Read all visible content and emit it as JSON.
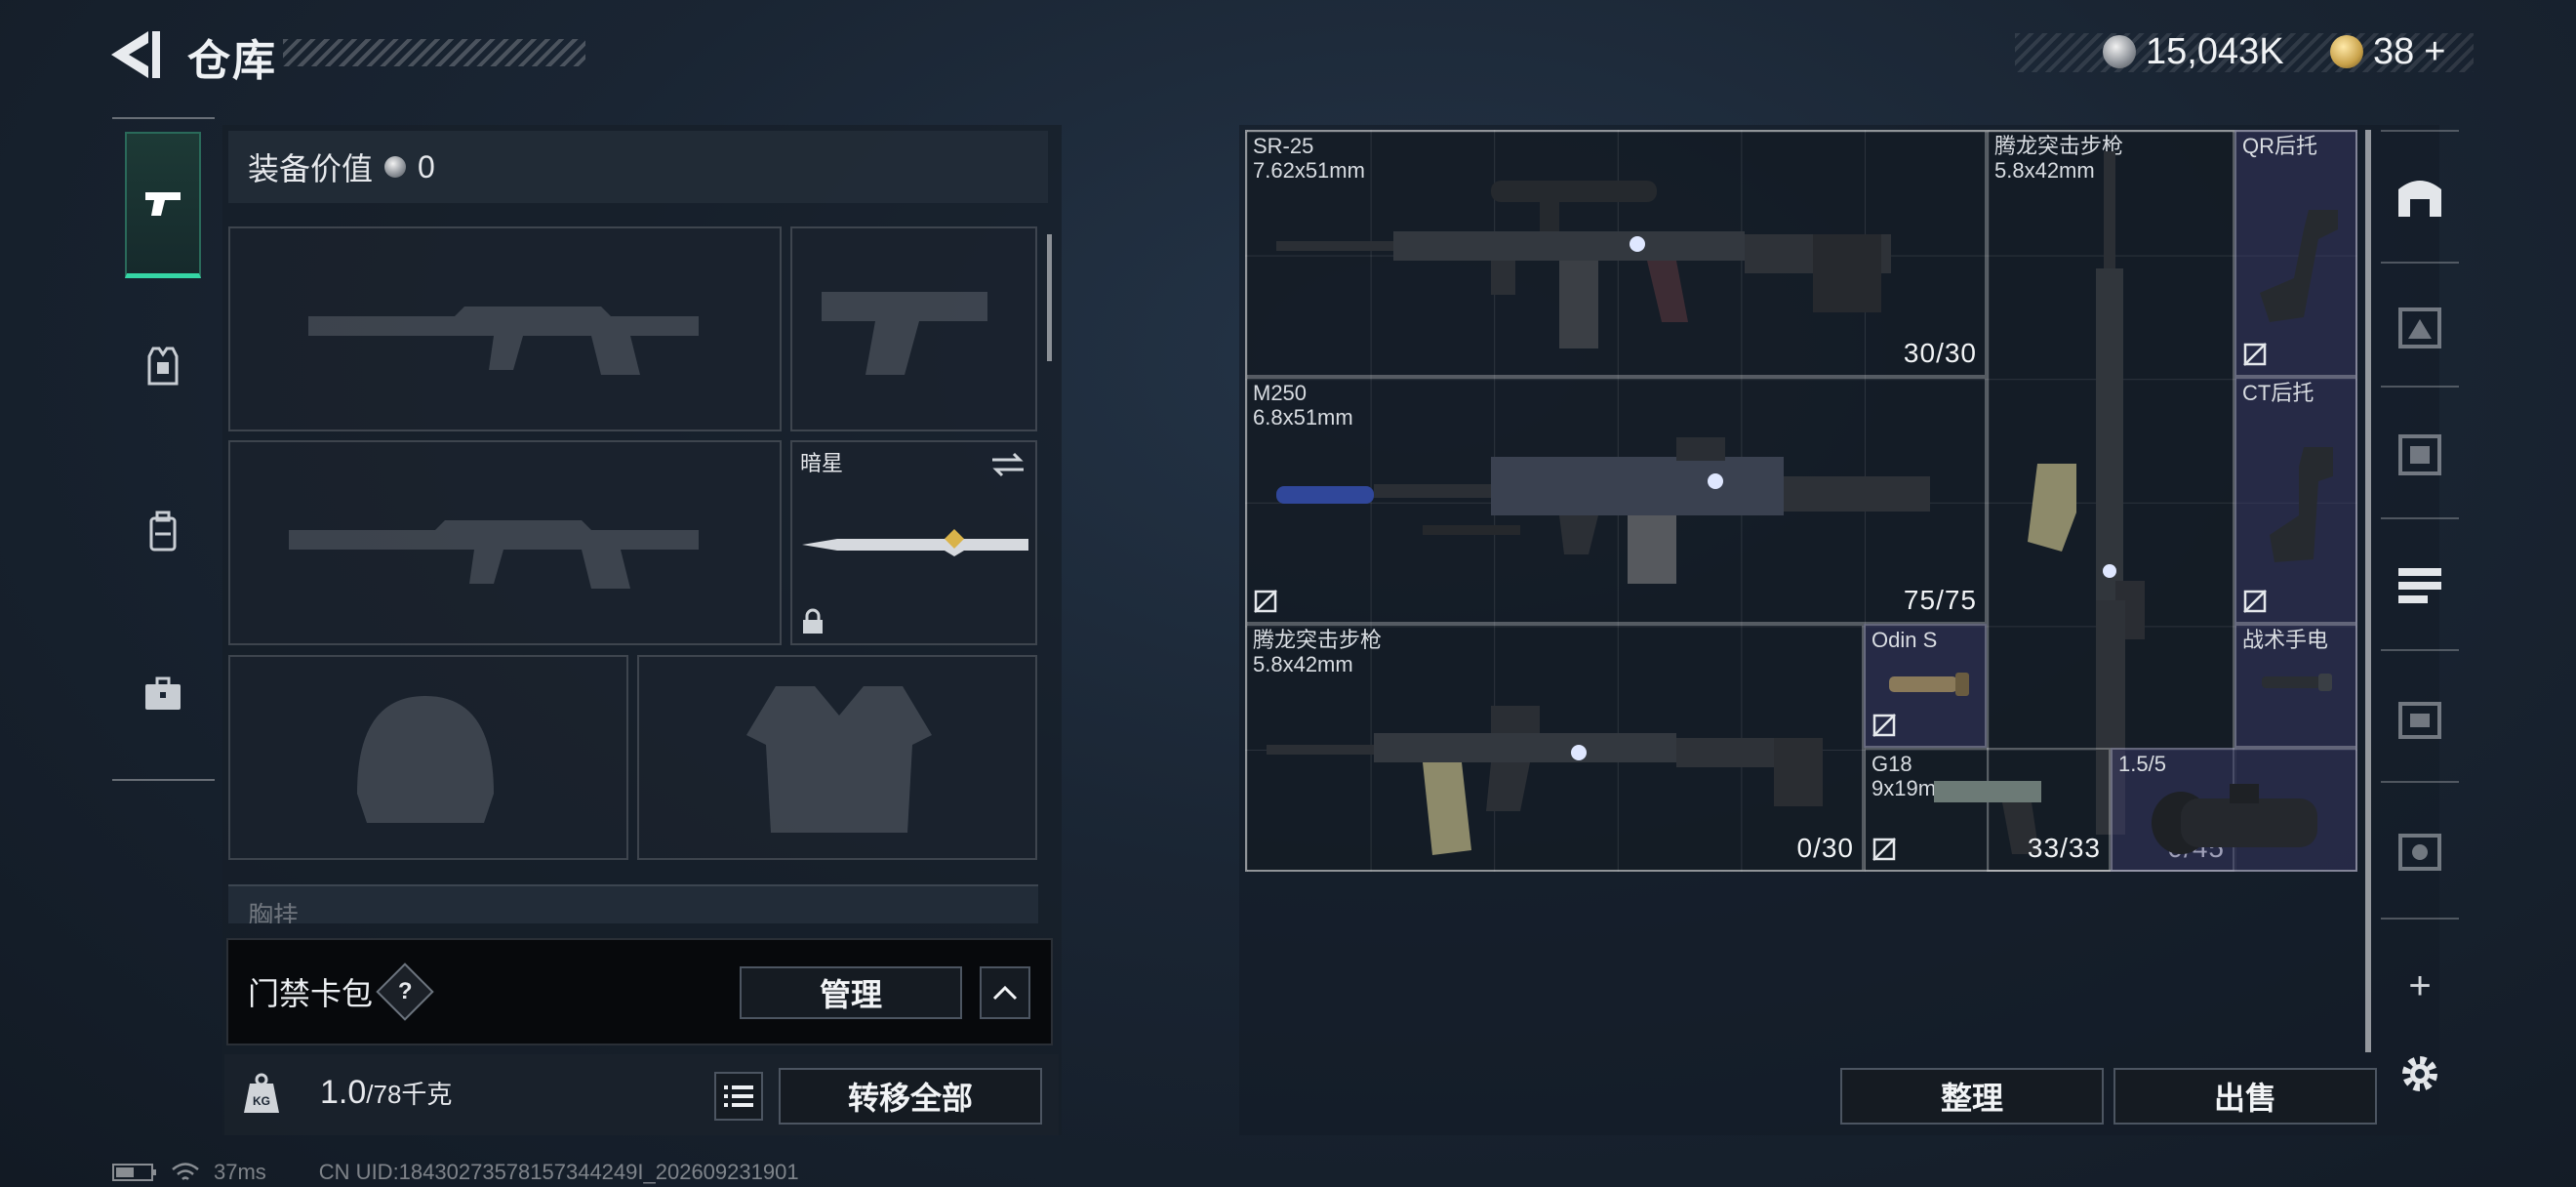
{
  "header": {
    "title": "仓库",
    "silver_amount": "15,043K",
    "gold_amount": "38",
    "gold_plus": "+"
  },
  "equipment": {
    "value_label": "装备价值",
    "value_amount": "0",
    "knife_name": "暗星",
    "chest_label": "胸挂"
  },
  "card_bag": {
    "label": "门禁卡包",
    "help": "?",
    "manage_label": "管理"
  },
  "weight": {
    "current": "1.0",
    "max": "/78",
    "unit": "千克",
    "transfer_all_label": "转移全部"
  },
  "storage": {
    "items": [
      {
        "name": "SR-25\n7.62x51mm",
        "count": "30/30"
      },
      {
        "name": "腾龙突击步枪\n5.8x42mm",
        "count": "0/45"
      },
      {
        "name": "QR后托",
        "count": ""
      },
      {
        "name": "M250\n6.8x51mm",
        "count": "75/75"
      },
      {
        "name": "CT后托",
        "count": ""
      },
      {
        "name": "腾龙突击步枪\n5.8x42mm",
        "count": "0/30"
      },
      {
        "name": "Odin S",
        "count": ""
      },
      {
        "name": "战术手电",
        "count": ""
      },
      {
        "name": "G18\n9x19mm",
        "count": "33/33"
      },
      {
        "name": "1.5/5",
        "count": ""
      }
    ],
    "sort_label": "整理",
    "sell_label": "出售",
    "add_label": "+"
  },
  "footer": {
    "ping": "37ms",
    "uid": "CN UID:18430273578157344249I_202609231901"
  },
  "colors": {
    "accent_green": "#35d6a5",
    "highlight_cell": "#3c3c6e"
  }
}
